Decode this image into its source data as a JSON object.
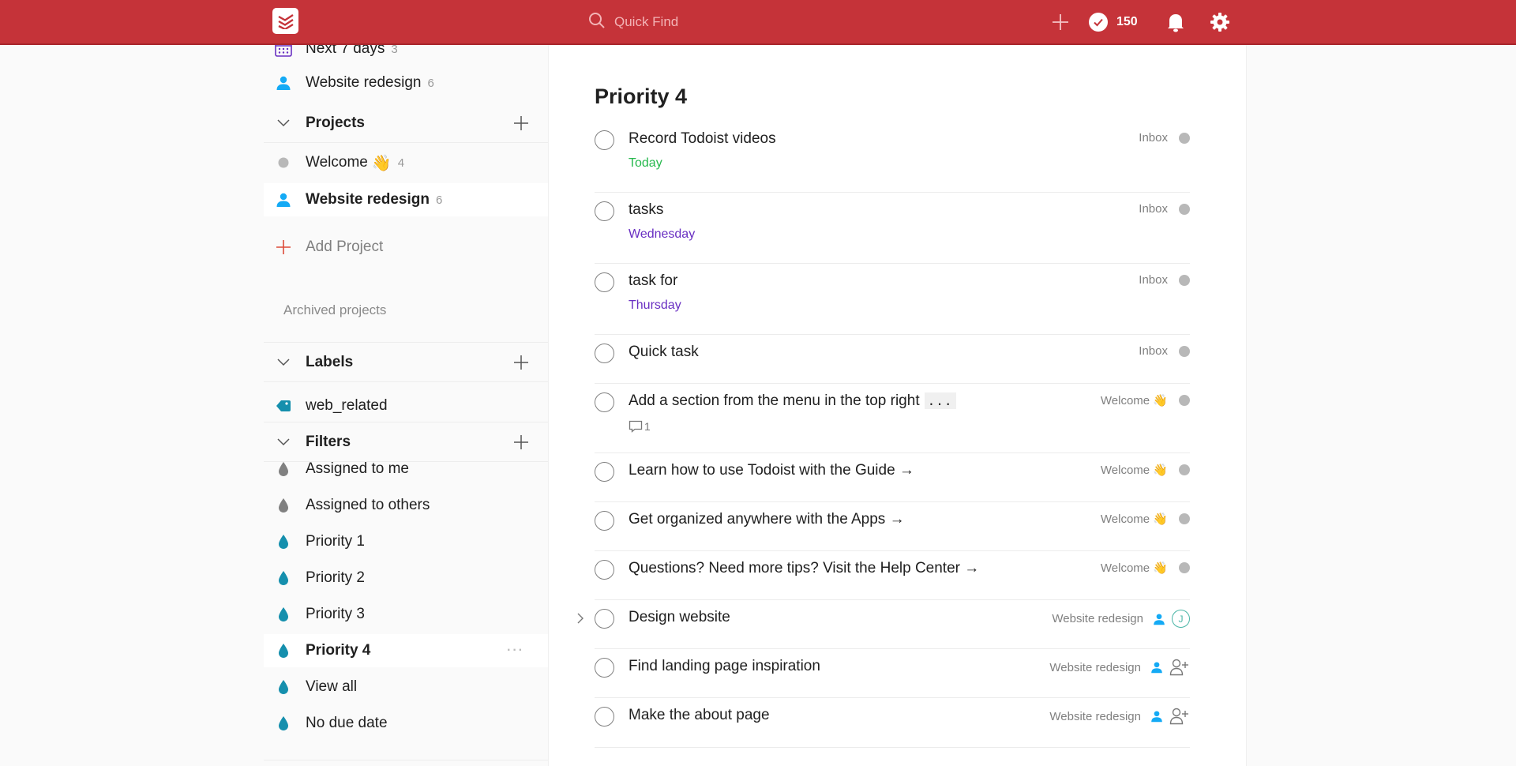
{
  "topbar": {
    "search_placeholder": "Quick Find",
    "karma_count": "150",
    "brand_color": "#c53339",
    "icons": [
      "todoist-logo-icon",
      "search-icon",
      "plus-icon",
      "karma-check-icon",
      "bell-icon",
      "gear-icon"
    ]
  },
  "sidebar": {
    "top_items": [
      {
        "label": "Next 7 days",
        "count": "3",
        "icon": "calendar-icon"
      },
      {
        "label": "Website redesign",
        "count": "6",
        "icon": "person-icon"
      }
    ],
    "projects": {
      "title": "Projects",
      "items": [
        {
          "label": "Welcome",
          "emoji": "👋",
          "count": "4",
          "icon": "grey-dot-icon",
          "active": false
        },
        {
          "label": "Website redesign",
          "count": "6",
          "icon": "person-icon",
          "active": true
        }
      ],
      "add_label": "Add Project",
      "archived_label": "Archived projects"
    },
    "labels": {
      "title": "Labels",
      "items": [
        {
          "label": "web_related",
          "icon": "tag-icon"
        }
      ]
    },
    "filters": {
      "title": "Filters",
      "items": [
        {
          "label": "Assigned to me",
          "color": "#808080"
        },
        {
          "label": "Assigned to others",
          "color": "#808080"
        },
        {
          "label": "Priority 1",
          "color": "#158fad"
        },
        {
          "label": "Priority 2",
          "color": "#158fad"
        },
        {
          "label": "Priority 3",
          "color": "#158fad"
        },
        {
          "label": "Priority 4",
          "color": "#158fad",
          "active": true
        },
        {
          "label": "View all",
          "color": "#158fad"
        },
        {
          "label": "No due date",
          "color": "#158fad"
        }
      ],
      "more_label": "···"
    }
  },
  "main": {
    "title": "Priority 4",
    "tasks": [
      {
        "content": "Record Todoist videos",
        "due": "Today",
        "due_color": "#25b84c",
        "project": "Inbox"
      },
      {
        "content": "tasks",
        "due": "Wednesday",
        "due_color": "#692fc2",
        "project": "Inbox"
      },
      {
        "content": "task for",
        "due": "Thursday",
        "due_color": "#692fc2",
        "project": "Inbox"
      },
      {
        "content": "Quick task",
        "project": "Inbox"
      },
      {
        "content": "Add a section from the menu in the top right",
        "code": "...",
        "comments": "1",
        "project": "Welcome",
        "project_emoji": "👋"
      },
      {
        "content": "Learn how to use Todoist with the Guide →",
        "project": "Welcome",
        "project_emoji": "👋"
      },
      {
        "content": "Get organized anywhere with the Apps →",
        "project": "Welcome",
        "project_emoji": "👋"
      },
      {
        "content": "Questions? Need more tips? Visit the Help Center →",
        "project": "Welcome",
        "project_emoji": "👋"
      },
      {
        "content": "Design website",
        "project": "Website redesign",
        "assignee_initial": "J",
        "has_subtasks": true
      },
      {
        "content": "Find landing page inspiration",
        "project": "Website redesign"
      },
      {
        "content": "Make the about page",
        "project": "Website redesign"
      }
    ]
  }
}
